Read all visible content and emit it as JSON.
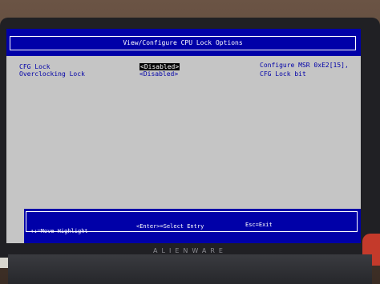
{
  "bios": {
    "title": "View/Configure CPU Lock Options",
    "settings": [
      {
        "label": "CFG Lock",
        "value": "<Disabled>"
      },
      {
        "label": "Overclocking Lock",
        "value": "<Disabled>"
      }
    ],
    "help_text": "Configure MSR 0xE2[15], CFG Lock bit",
    "footer": {
      "move_highlight": "↑↓=Move Highlight",
      "select_entry": "<Enter>=Select Entry",
      "exit": "Esc=Exit"
    }
  },
  "laptop": {
    "brand": "ALIENWARE"
  },
  "colors": {
    "bios_blue": "#0000a8",
    "screen_gray": "#c5c5c5",
    "highlight_black": "#000000"
  }
}
